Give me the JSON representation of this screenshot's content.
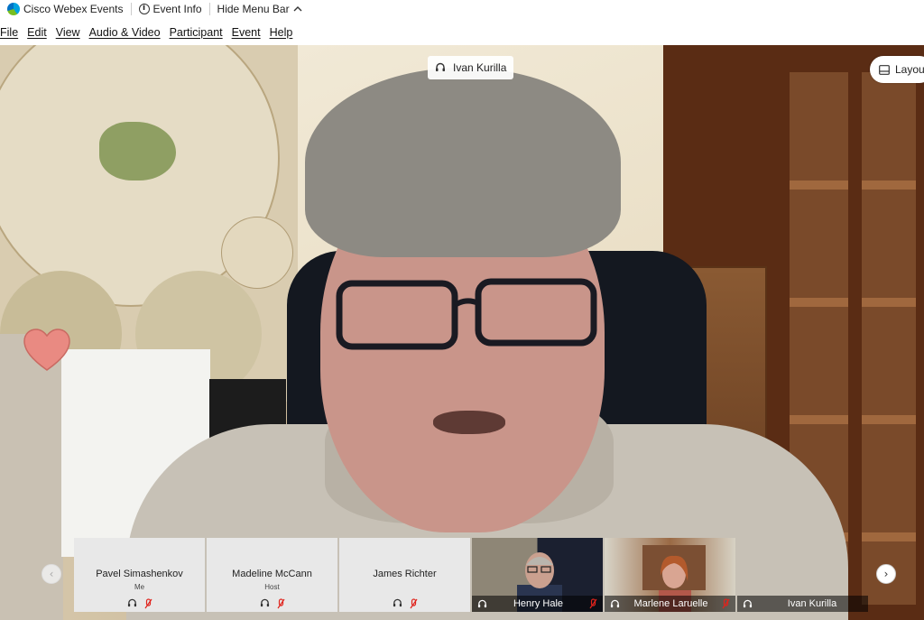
{
  "titlebar": {
    "app_name": "Cisco Webex Events",
    "event_info": "Event Info",
    "hide_menu_bar": "Hide Menu Bar"
  },
  "menu": [
    {
      "label": "File"
    },
    {
      "label": "Edit"
    },
    {
      "label": "View"
    },
    {
      "label": "Audio & Video"
    },
    {
      "label": "Participant"
    },
    {
      "label": "Event"
    },
    {
      "label": "Help"
    }
  ],
  "active_speaker": {
    "name": "Ivan Kurilla"
  },
  "layout_button": {
    "label": "Layout"
  },
  "filmstrip": {
    "participants": [
      {
        "name": "Pavel Simashenkov",
        "role": "Me",
        "video": false,
        "muted": true
      },
      {
        "name": "Madeline McCann",
        "role": "Host",
        "video": false,
        "muted": true
      },
      {
        "name": "James Richter",
        "role": "",
        "video": false,
        "muted": true
      },
      {
        "name": "Henry Hale",
        "role": "",
        "video": true,
        "muted": true
      },
      {
        "name": "Marlene Laruelle",
        "role": "",
        "video": true,
        "muted": true
      },
      {
        "name": "Ivan Kurilla",
        "role": "",
        "video": true,
        "muted": false
      }
    ]
  },
  "colors": {
    "mute_red": "#e0231c",
    "webex_blue": "#00a3e0",
    "webex_green": "#78be20"
  },
  "icons": [
    "webex-logo-icon",
    "info-icon",
    "chevron-up-icon",
    "headset-icon",
    "mic-muted-icon",
    "layout-icon",
    "chevron-left-icon",
    "chevron-right-icon",
    "heart-reaction-icon"
  ]
}
